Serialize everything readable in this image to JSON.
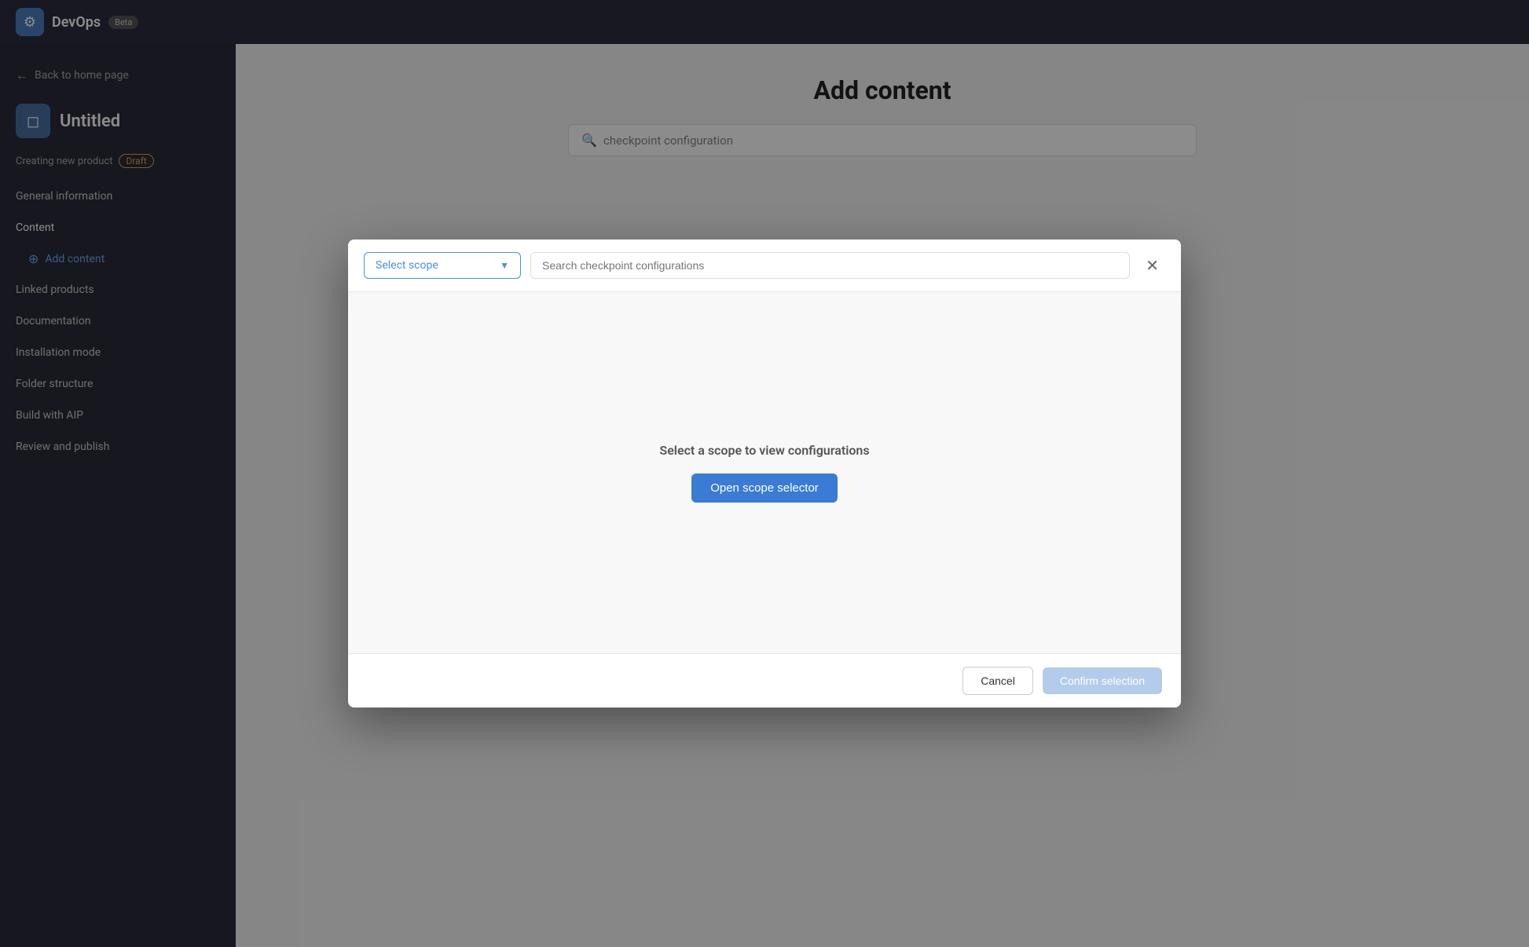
{
  "app": {
    "logo_icon": "⚙",
    "title": "DevOps",
    "badge": "Beta"
  },
  "sidebar": {
    "back_label": "Back to home page",
    "product_icon": "◻",
    "product_name": "Untitled",
    "status_label": "Creating new product",
    "draft_label": "Draft",
    "nav_items": [
      {
        "label": "General information",
        "active": false
      },
      {
        "label": "Content",
        "active": true
      },
      {
        "label": "Add content",
        "active": false,
        "indented": true
      },
      {
        "label": "Linked products",
        "active": false
      },
      {
        "label": "Documentation",
        "active": false
      },
      {
        "label": "Installation mode",
        "active": false
      },
      {
        "label": "Folder structure",
        "active": false
      },
      {
        "label": "Build with AIP",
        "active": false
      },
      {
        "label": "Review and publish",
        "active": false
      }
    ]
  },
  "main": {
    "title": "Add content",
    "search_placeholder": "checkpoint configuration"
  },
  "modal": {
    "scope_placeholder": "Select scope",
    "search_placeholder": "Search checkpoint configurations",
    "empty_text": "Select a scope to view configurations",
    "open_scope_btn": "Open scope selector",
    "cancel_btn": "Cancel",
    "confirm_btn": "Confirm selection"
  }
}
